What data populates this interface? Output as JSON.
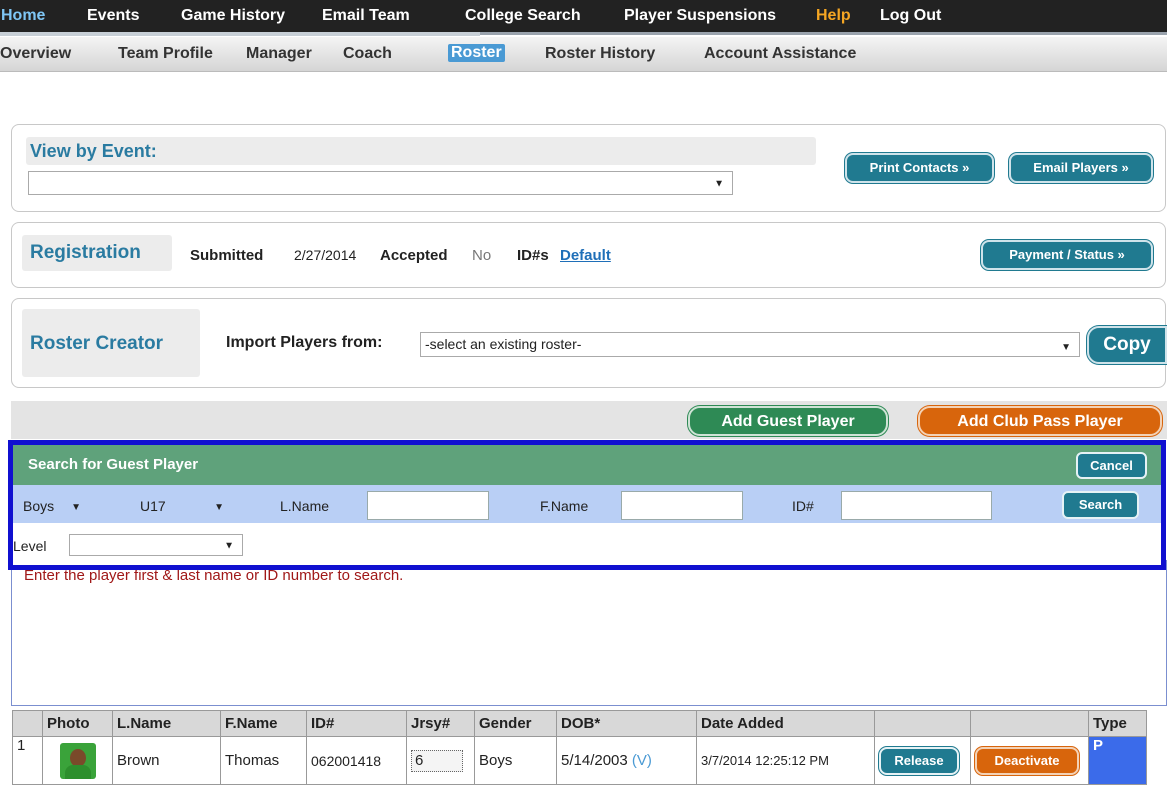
{
  "topnav": {
    "items": [
      "Home",
      "Events",
      "Game History",
      "Email Team",
      "College Search",
      "Player Suspensions",
      "Help",
      "Log Out"
    ]
  },
  "subnav": {
    "items": [
      "Overview",
      "Team Profile",
      "Manager",
      "Coach",
      "Roster",
      "Roster History",
      "Account Assistance"
    ],
    "active": "Roster"
  },
  "view_by_event": {
    "title": "View by Event:",
    "print_contacts": "Print Contacts »",
    "email_players": "Email Players »"
  },
  "registration": {
    "title": "Registration",
    "submitted_label": "Submitted",
    "submitted_value": "2/27/2014",
    "accepted_label": "Accepted",
    "accepted_value": "No",
    "ids_label": "ID#s",
    "ids_value": "Default",
    "payment_button": "Payment / Status »"
  },
  "roster_creator": {
    "title": "Roster Creator",
    "import_label": "Import Players from:",
    "import_value": "-select an existing roster-",
    "copy_button": "Copy"
  },
  "actions": {
    "add_guest": "Add Guest Player",
    "add_club_pass": "Add Club Pass Player"
  },
  "search": {
    "title": "Search for Guest Player",
    "cancel": "Cancel",
    "gender": "Boys",
    "age": "U17",
    "lname_label": "L.Name",
    "fname_label": "F.Name",
    "id_label": "ID#",
    "search_button": "Search",
    "level_label": "Level",
    "hint": "Enter the player first & last name or ID number to search."
  },
  "roster_table": {
    "headers": [
      "",
      "Photo",
      "L.Name",
      "F.Name",
      "ID#",
      "Jrsy#",
      "Gender",
      "DOB*",
      "Date Added",
      "",
      "",
      "Type"
    ],
    "rows": [
      {
        "num": "1",
        "lname": "Brown",
        "fname": "Thomas",
        "id": "062001418",
        "jersey": "6",
        "gender": "Boys",
        "dob": "5/14/2003",
        "dob_v": "(V)",
        "date_added": "3/7/2014 12:25:12 PM",
        "release": "Release",
        "deactivate": "Deactivate",
        "type": "P"
      }
    ]
  },
  "colors": {
    "teal": "#207a90",
    "green": "#2e8a55",
    "orange": "#d8650c",
    "search_header": "#5fa27b",
    "search_row": "#b9cff5",
    "highlight_border": "#1010d0"
  }
}
